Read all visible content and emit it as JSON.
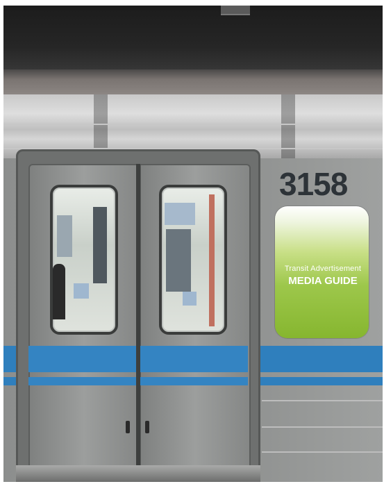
{
  "train": {
    "car_number": "3158"
  },
  "badge": {
    "subtitle": "Transit Advertisement",
    "title": "MEDIA GUIDE"
  },
  "colors": {
    "accent_stripe": "#2f7fbd",
    "badge_green": "#86b62f"
  }
}
